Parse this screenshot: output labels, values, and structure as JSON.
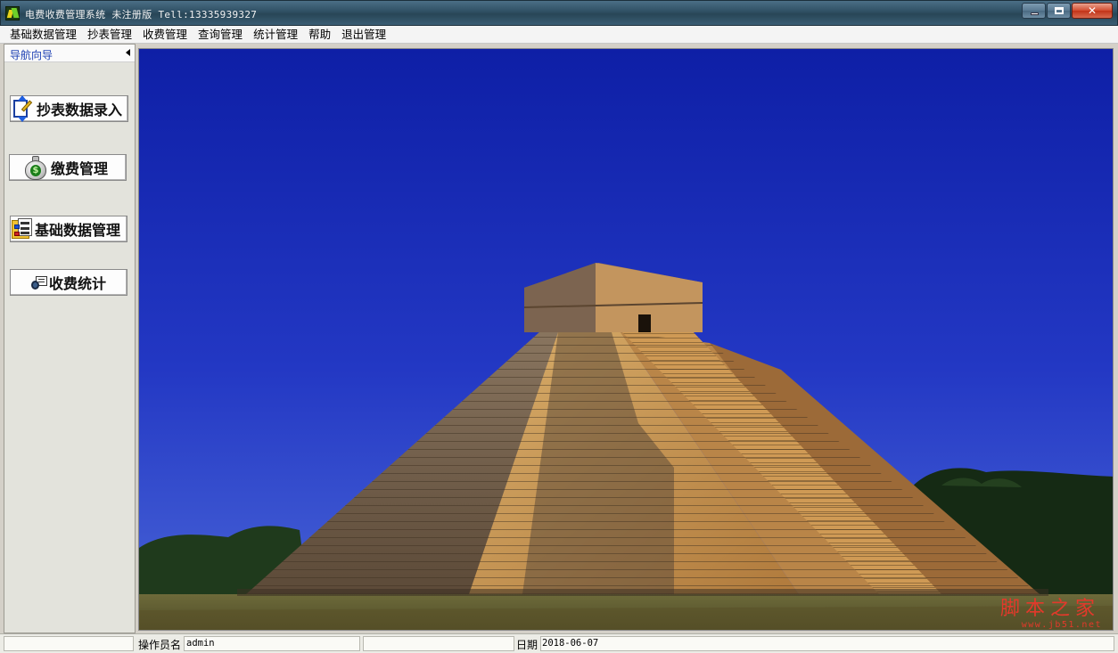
{
  "window": {
    "title": "电费收费管理系统  未注册版 Tell:13335939327",
    "minimize_glyph": "–",
    "maximize_glyph": "□",
    "close_glyph": "✕"
  },
  "menubar": {
    "items": [
      "基础数据管理",
      "抄表管理",
      "收费管理",
      "查询管理",
      "统计管理",
      "帮助",
      "退出管理"
    ]
  },
  "sidebar": {
    "title": "导航向导",
    "buttons": [
      {
        "label": "抄表数据录入",
        "icon": "edit-notebook-icon"
      },
      {
        "label": "缴费管理",
        "icon": "money-bag-icon"
      },
      {
        "label": "基础数据管理",
        "icon": "folder-list-icon"
      },
      {
        "label": "收费统计",
        "icon": "stats-icon"
      }
    ]
  },
  "main": {
    "image_subject": "pyramid-photo"
  },
  "statusbar": {
    "operator_label": "操作员名",
    "operator_value": "admin",
    "date_label": "日期",
    "date_value": "2018-06-07"
  },
  "watermark": {
    "text": "脚本之家",
    "url": "www.jb51.net"
  },
  "colors": {
    "sky_top": "#0e1fa6",
    "sky_bottom": "#4a66d8",
    "stone_lit": "#c89a5a",
    "stone_shadow": "#6e5a46",
    "nav_title": "#1b3fb3",
    "watermark": "#e3392b"
  }
}
